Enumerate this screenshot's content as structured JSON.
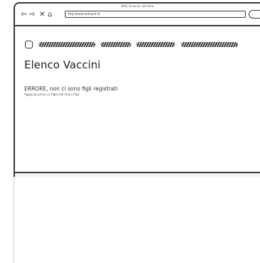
{
  "window": {
    "title": "Web browser window"
  },
  "address_bar": {
    "url": "http://www.example.it/"
  },
  "nav_icons": {
    "back": "back-arrow-icon",
    "forward": "forward-arrow-icon",
    "stop": "close-icon",
    "home": "home-icon"
  },
  "page": {
    "heading": "Elenco Vaccini",
    "error_message": "ERRORE, non ci sono figli registrati",
    "hint_message": "Aggiungi prima un figlio dal menu Figli"
  }
}
